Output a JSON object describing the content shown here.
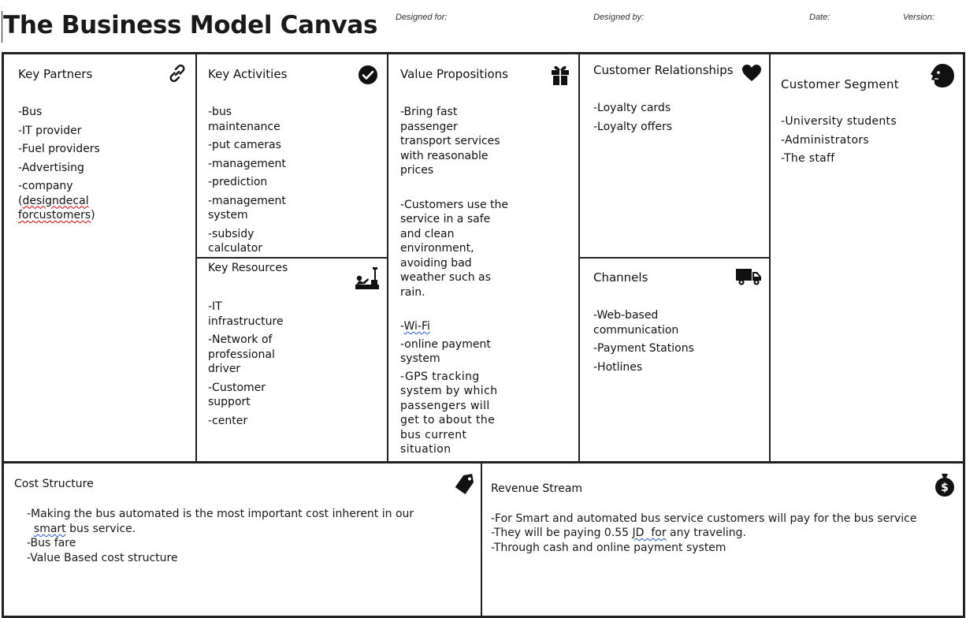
{
  "header": {
    "title": "The Business Model Canvas",
    "designed_for": "Designed for:",
    "designed_by": "Designed by:",
    "date": "Date:",
    "version": "Version:"
  },
  "key_partners": {
    "title": "Key Partners",
    "icon": "link-icon",
    "items": [
      "-Bus",
      "-IT provider",
      "-Fuel providers",
      "-Advertising",
      "-company"
    ],
    "item5_paren_open": "(",
    "item5_word1": "designdecal",
    "item5_word2": "forcustomers",
    "item5_paren_close": ")"
  },
  "key_activities": {
    "title": "Key Activities",
    "icon": "checkmark-icon",
    "items": [
      "-bus maintenance",
      "-put cameras",
      "-management",
      "-prediction",
      "-management system",
      "-subsidy calculator"
    ]
  },
  "key_resources": {
    "title": "Key Resources",
    "icon": "factory-icon",
    "items": [
      "-IT infrastructure",
      "-Network of professional driver",
      "-Customer support",
      "-center"
    ]
  },
  "value_propositions": {
    "title": "Value Propositions",
    "icon": "gift-icon",
    "items": [
      "-Bring fast passenger transport services with reasonable prices",
      "-Customers use the service in a safe and clean environment, avoiding bad weather such as rain."
    ],
    "wifi_dash": "-",
    "wifi_word": "Wi-Fi",
    "items2": [
      "-online payment system",
      "-GPS tracking system by which passengers will get to about the bus current situation"
    ]
  },
  "customer_relationships": {
    "title": "Customer Relationships",
    "icon": "heart-icon",
    "items": [
      "-Loyalty cards",
      "-Loyalty offers"
    ]
  },
  "channels": {
    "title": "Channels",
    "icon": "truck-icon",
    "items": [
      "-Web-based communication",
      "-Payment Stations",
      "-Hotlines"
    ]
  },
  "customer_segment": {
    "title": "Customer Segment",
    "icon": "face-icon",
    "items": [
      "-University students",
      "-Administrators",
      "-The staff"
    ]
  },
  "cost_structure": {
    "title": "Cost Structure",
    "icon": "price-tag-icon",
    "line1": "-Making the bus automated is the most important cost inherent in our",
    "line2_pre": "  ",
    "line2_word": "smart",
    "line2_post": " bus service.",
    "line3": "-Bus fare",
    "line4": "-Value Based cost structure"
  },
  "revenue_stream": {
    "title": "Revenue Stream",
    "icon": "money-bag-icon",
    "line1": "-For Smart and automated bus service customers will pay for the bus service",
    "line2_pre": "-They will be paying 0.55 ",
    "line2_word": "JD  for",
    "line2_post": " any traveling.",
    "line3": "-Through cash and online payment system"
  }
}
